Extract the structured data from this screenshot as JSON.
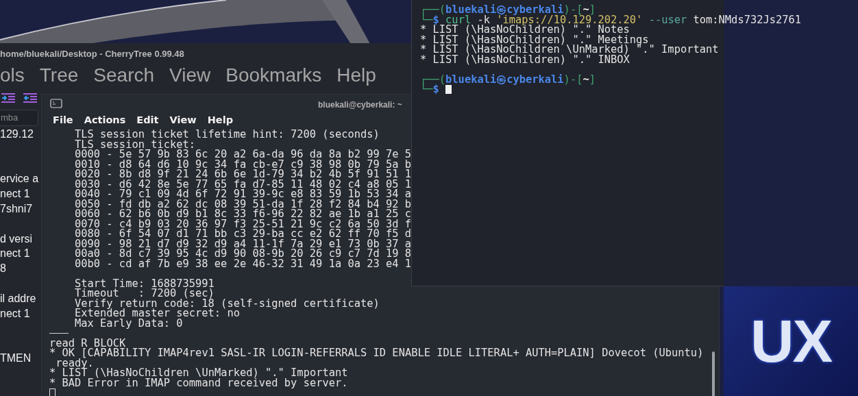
{
  "wallpaper": {
    "logo_text": "UX"
  },
  "cherrytree": {
    "title": "home/bluekali/Desktop - CherryTree 0.99.48",
    "menu": [
      "ols",
      "Tree",
      "Search",
      "View",
      "Bookmarks",
      "Help"
    ],
    "search": {
      "value": "mba"
    },
    "tree_groups": [
      [
        "129.12"
      ],
      [
        "ervice a",
        "nect 1",
        "7shni7"
      ],
      [
        "d versi",
        "nect 1",
        "8"
      ],
      [
        "il addre",
        "nect 1"
      ],
      [
        "TMEN"
      ]
    ]
  },
  "terminal_back": {
    "title": "bluekali@cyberkali: ~",
    "focused": false,
    "menu": [
      "File",
      "Actions",
      "Edit",
      "View",
      "Help"
    ],
    "session_ticket": [
      "TLS session ticket lifetime hint: 7200 (seconds)",
      "TLS session ticket:",
      "0000 - 5e 57 9b 83 6c 20 a2 6a-da 96 da 8a b2 99 7e 5",
      "0010 - d8 64 d6 10 9c 34 fa cb-e7 c9 38 98 0b 79 5a b",
      "0020 - 8b d8 9f 21 24 6b 6e 1d-79 34 b2 4b 5f 91 51 1",
      "0030 - d6 42 8e 5e 77 65 fa d7-85 11 48 02 c4 a8 05 1",
      "0040 - 79 c1 09 4d 6f 72 91 39-9c e8 83 59 1b 53 34 a",
      "0050 - fd db a2 62 dc 08 39 51-da 1f 28 f2 84 b4 92 b",
      "0060 - 62 b6 0b d9 b1 8c 33 f6-96 22 82 ae 1b a1 25 c",
      "0070 - c4 b9 03 20 36 97 f3 25-51 21 9c c2 6a 50 3d f",
      "0080 - 6f 54 07 d1 71 bb c3 29-ba cc e2 62 ff 70 f5 d",
      "0090 - 98 21 d7 d9 32 d9 a4 11-1f 7a 29 e1 73 0b 37 a",
      "00a0 - 8d c7 39 95 4c d9 90 08-9b 20 26 c9 c7 7d 19 8",
      "00b0 - cd af 7b e9 38 ee 2e 46-32 31 49 1a 0a 23 e4 1"
    ],
    "session_info": [
      "Start Time: 1688735991",
      "Timeout   : 7200 (sec)",
      "Verify return code: 18 (self-signed certificate)",
      "Extended master secret: no",
      "Max Early Data: 0"
    ],
    "imap_output": [
      "read R BLOCK",
      "* OK [CAPABILITY IMAP4rev1 SASL-IR LOGIN-REFERRALS ID ENABLE IDLE LITERAL+ AUTH=PLAIN] Dovecot (Ubuntu)",
      " ready.",
      "* LIST (\\HasNoChildren \\UnMarked) \".\" Important",
      "* BAD Error in IMAP command received by server."
    ],
    "cursor": true
  },
  "terminal_front": {
    "focused": true,
    "lines": [
      {
        "segments": [
          {
            "text": "┌──(",
            "kind": "frame"
          },
          {
            "text": "bluekali㉿cyberkali",
            "kind": "host"
          },
          {
            "text": ")-[",
            "kind": "frame"
          },
          {
            "text": "~",
            "kind": "dir"
          },
          {
            "text": "]",
            "kind": "frame"
          }
        ]
      },
      {
        "segments": [
          {
            "text": "└─",
            "kind": "frame"
          },
          {
            "text": "$ ",
            "kind": "host"
          },
          {
            "text": "curl",
            "kind": "command"
          },
          {
            "text": " -k ",
            "kind": "plain"
          },
          {
            "text": "'imaps://10.129.202.20'",
            "kind": "string"
          },
          {
            "text": " --user ",
            "kind": "option"
          },
          {
            "text": "tom:NMds732Js2761",
            "kind": "plain"
          }
        ]
      },
      {
        "segments": [
          {
            "text": "* LIST (\\HasNoChildren) \".\" Notes",
            "kind": "plain"
          }
        ]
      },
      {
        "segments": [
          {
            "text": "* LIST (\\HasNoChildren) \".\" Meetings",
            "kind": "plain"
          }
        ]
      },
      {
        "segments": [
          {
            "text": "* LIST (\\HasNoChildren \\UnMarked) \".\" Important",
            "kind": "plain"
          }
        ]
      },
      {
        "segments": [
          {
            "text": "* LIST (\\HasNoChildren) \".\" INBOX",
            "kind": "plain"
          }
        ]
      },
      {
        "gap": true,
        "segments": [
          {
            "text": "┌──(",
            "kind": "frame"
          },
          {
            "text": "bluekali㉿cyberkali",
            "kind": "host"
          },
          {
            "text": ")-[",
            "kind": "frame"
          },
          {
            "text": "~",
            "kind": "dir"
          },
          {
            "text": "]",
            "kind": "frame"
          }
        ]
      },
      {
        "cursor": true,
        "segments": [
          {
            "text": "└─",
            "kind": "frame"
          },
          {
            "text": "$ ",
            "kind": "host"
          }
        ]
      }
    ]
  }
}
